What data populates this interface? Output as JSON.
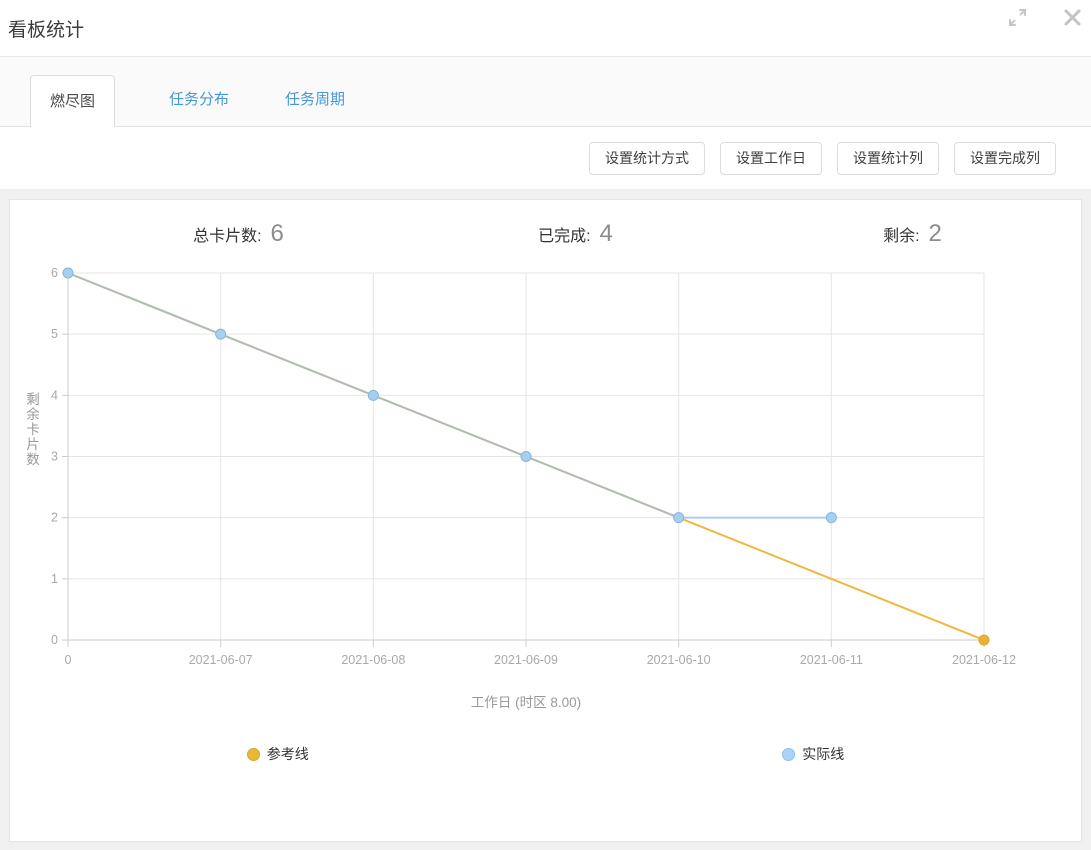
{
  "dialog": {
    "title": "看板统计",
    "expand_icon": "expand-diagonal-arrows",
    "close_icon": "close-x",
    "icon_color": "#c6c6c6"
  },
  "tabs": [
    {
      "label": "燃尽图",
      "active": true
    },
    {
      "label": "任务分布",
      "active": false
    },
    {
      "label": "任务周期",
      "active": false
    }
  ],
  "toolbar": {
    "buttons": [
      "设置统计方式",
      "设置工作日",
      "设置统计列",
      "设置完成列"
    ]
  },
  "stats": [
    {
      "label": "总卡片数:",
      "value": "6"
    },
    {
      "label": "已完成:",
      "value": "4"
    },
    {
      "label": "剩余:",
      "value": "2"
    }
  ],
  "chart_data": {
    "type": "line",
    "title": "",
    "x_categories": [
      "0",
      "2021-06-07",
      "2021-06-08",
      "2021-06-09",
      "2021-06-10",
      "2021-06-11",
      "2021-06-12"
    ],
    "series": [
      {
        "name": "参考线",
        "x": [
          0,
          6
        ],
        "values": [
          6,
          0
        ],
        "color": "#f0b73d",
        "opacity": 1,
        "marker_fill": "#e8b138",
        "marker_stroke": "#dca62f",
        "markers": "last"
      },
      {
        "name": "实际线",
        "x": [
          0,
          1,
          2,
          3,
          4,
          5
        ],
        "values": [
          6,
          5,
          4,
          3,
          2,
          2
        ],
        "color": "#8fc0e8",
        "opacity": 0.7,
        "marker_fill": "#a7cff0",
        "marker_stroke": "#82b5e0",
        "markers": "all"
      }
    ],
    "xlabel": "工作日 (时区 8.00)",
    "ylabel": "剩余卡片数",
    "ylim": [
      0,
      6
    ],
    "yticks": [
      0,
      1,
      2,
      3,
      4,
      5,
      6
    ],
    "grid": true,
    "grid_color": "#e5e5e5",
    "axis_color": "#cccccc",
    "tick_text_color": "#a9a9a9",
    "axis_title_color": "#999999",
    "legend_position": "bottom"
  },
  "legend": [
    {
      "label": "参考线",
      "color": "#e9b839",
      "border": "#d8a72e"
    },
    {
      "label": "实际线",
      "color": "#abd3f5",
      "border": "#8fc0ea"
    }
  ]
}
